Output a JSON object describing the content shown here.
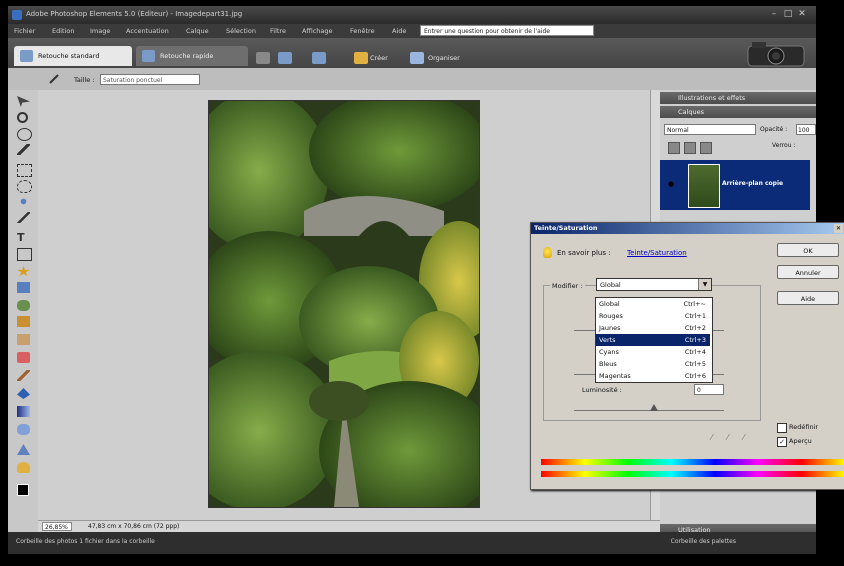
{
  "window": {
    "title": "Adobe Photoshop Elements 5.0 (Editeur) - Imagedepart31.jpg"
  },
  "menubar": {
    "items": [
      "Fichier",
      "Edition",
      "Image",
      "Accentuation",
      "Calque",
      "Sélection",
      "Filtre",
      "Affichage",
      "Fenêtre",
      "Aide"
    ],
    "help_placeholder": "Entrer une question pour obtenir de l'aide"
  },
  "modebar": {
    "tab_standard": "Retouche standard",
    "tab_rapide": "Retouche rapide",
    "create_label": "Créer",
    "organize_label": "Organiser"
  },
  "options": {
    "size_label": "Taille :",
    "size_value": "Saturation ponctuel"
  },
  "status": {
    "zoom": "26,85%",
    "doc_info": "47,83 cm x 70,86 cm (72 ppp)"
  },
  "palette": {
    "illustrations_header": "Illustrations et effets",
    "layers_header": "Calques",
    "blend_mode": "Normal",
    "opacity_label": "Opacité :",
    "opacity_value": "100",
    "lock_label": "Verrou :",
    "layer_name": "Arrière-plan copie",
    "utilisation_header": "Utilisation"
  },
  "bottombar": {
    "left": "Corbeille des photos  1 fichier dans la corbeille",
    "right": "Corbeille des palettes"
  },
  "dialog": {
    "title": "Teinte/Saturation",
    "learn_label": "En savoir plus :",
    "learn_link": "Teinte/Saturation",
    "ok": "OK",
    "cancel": "Annuler",
    "help": "Aide",
    "modify_label": "Modifier :",
    "modify_value": "Global",
    "options": [
      {
        "name": "Global",
        "shortcut": "Ctrl+~"
      },
      {
        "name": "Rouges",
        "shortcut": "Ctrl+1"
      },
      {
        "name": "Jaunes",
        "shortcut": "Ctrl+2"
      },
      {
        "name": "Verts",
        "shortcut": "Ctrl+3"
      },
      {
        "name": "Cyans",
        "shortcut": "Ctrl+4"
      },
      {
        "name": "Bleus",
        "shortcut": "Ctrl+5"
      },
      {
        "name": "Magentas",
        "shortcut": "Ctrl+6"
      }
    ],
    "selected_option": "Verts",
    "luminosity_label": "Luminosité :",
    "luminosity_value": "0",
    "colorize_label": "Redéfinir",
    "colorize_checked": false,
    "preview_label": "Aperçu",
    "preview_checked": true
  },
  "colors": {
    "selection": "#0a246a",
    "accent": "#3a6fbf"
  }
}
